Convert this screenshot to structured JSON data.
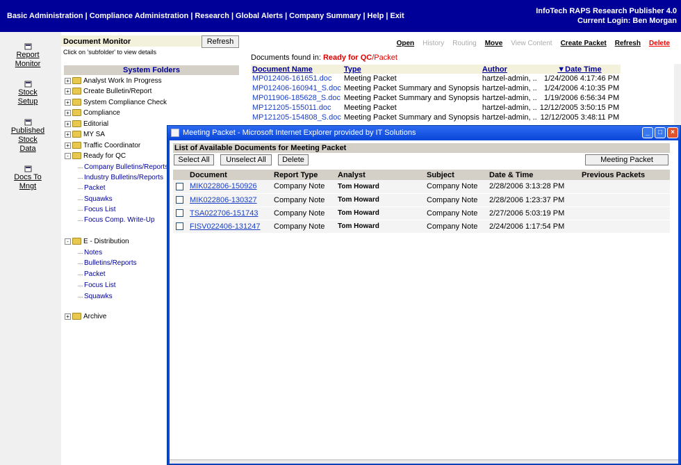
{
  "topnav": {
    "items": [
      "Basic Administration",
      "Compliance Administration",
      "Research",
      "Global Alerts",
      "Company Summary",
      "Help",
      "Exit"
    ],
    "separator": "|"
  },
  "brand": {
    "app_name": "InfoTech RAPS Research Publisher 4.0",
    "login": "Current Login: Ben Morgan"
  },
  "leftnav": {
    "items": [
      {
        "icon": "report-monitor-icon",
        "line1": "Report",
        "line2": "Monitor"
      },
      {
        "icon": "stock-setup-icon",
        "line1": "Stock",
        "line2": "Setup"
      },
      {
        "icon": "published-stock-data-icon",
        "line1": "Published",
        "line2": "Stock",
        "line3": "Data"
      },
      {
        "icon": "docs-to-mngt-icon",
        "line1": "Docs To",
        "line2": "Mngt"
      }
    ]
  },
  "monitor": {
    "title": "Document Monitor",
    "refresh_label": "Refresh",
    "hint": "Click on 'subfolder' to view details",
    "system_folders": "System Folders"
  },
  "tree": {
    "top": [
      {
        "label": "Analyst Work In Progress",
        "expander": "+"
      },
      {
        "label": "Create Bulletin/Report",
        "expander": "+"
      },
      {
        "label": "System Compliance Check",
        "expander": "+"
      },
      {
        "label": "Compliance",
        "expander": "+"
      },
      {
        "label": "Editorial",
        "expander": "+"
      },
      {
        "label": "MY SA",
        "expander": "+"
      },
      {
        "label": "Traffic Coordinator",
        "expander": "+"
      },
      {
        "label": "Ready for QC",
        "expander": "-"
      }
    ],
    "qc_children": [
      "Company Bulletins/Reports",
      "Industry Bulletins/Reports",
      "Packet",
      "Squawks",
      "Focus List",
      "Focus Comp. Write-Up"
    ],
    "edist": {
      "label": "E - Distribution",
      "expander": "-"
    },
    "edist_children": [
      "Notes",
      "Bulletins/Reports",
      "Packet",
      "Focus List",
      "Squawks"
    ],
    "archive": {
      "label": "Archive",
      "expander": "+"
    }
  },
  "actions": {
    "open": "Open",
    "history": "History",
    "routing": "Routing",
    "move": "Move",
    "view_content": "View Content",
    "create_packet": "Create Packet",
    "refresh": "Refresh",
    "delete": "Delete"
  },
  "found": {
    "prefix": "Documents found in: ",
    "folder": "Ready for QC",
    "subfolder": "/Packet"
  },
  "doc_table": {
    "headers": {
      "name": "Document Name",
      "type": "Type",
      "author": "Author",
      "date": "▼Date Time"
    },
    "rows": [
      {
        "name": "MP012406-161651.doc",
        "type": "Meeting Packet",
        "author": "hartzel-admin, ..",
        "date": "1/24/2006 4:17:46 PM"
      },
      {
        "name": "MP012406-160941_S.doc",
        "type": "Meeting Packet Summary and Synopsis",
        "author": "hartzel-admin, ..",
        "date": "1/24/2006 4:10:35 PM"
      },
      {
        "name": "MP011906-185628_S.doc",
        "type": "Meeting Packet Summary and Synopsis",
        "author": "hartzel-admin, ..",
        "date": "1/19/2006 6:56:34 PM"
      },
      {
        "name": "MP121205-155011.doc",
        "type": "Meeting Packet",
        "author": "hartzel-admin, ..",
        "date": "12/12/2005 3:50:15 PM"
      },
      {
        "name": "MP121205-154808_S.doc",
        "type": "Meeting Packet Summary and Synopsis",
        "author": "hartzel-admin, ..",
        "date": "12/12/2005 3:48:11 PM"
      }
    ]
  },
  "popup": {
    "title": "Meeting Packet - Microsoft Internet Explorer provided by IT Solutions",
    "list_header": "List of Available Documents for Meeting Packet",
    "select_all": "Select All",
    "unselect_all": "Unselect All",
    "delete": "Delete",
    "meeting_packet": "Meeting Packet",
    "headers": {
      "document": "Document",
      "report_type": "Report Type",
      "analyst": "Analyst",
      "subject": "Subject",
      "datetime": "Date & Time",
      "previous": "Previous Packets"
    },
    "rows": [
      {
        "document": "MIK022806-150926",
        "report_type": "Company Note",
        "analyst": "Tom Howard",
        "subject": "Company Note",
        "datetime": "2/28/2006 3:13:28 PM",
        "previous": ""
      },
      {
        "document": "MIK022806-130327",
        "report_type": "Company Note",
        "analyst": "Tom Howard",
        "subject": "Company Note",
        "datetime": "2/28/2006 1:23:37 PM",
        "previous": ""
      },
      {
        "document": "TSA022706-151743",
        "report_type": "Company Note",
        "analyst": "Tom Howard",
        "subject": "Company Note",
        "datetime": "2/27/2006 5:03:19 PM",
        "previous": ""
      },
      {
        "document": "FISV022406-131247",
        "report_type": "Company Note",
        "analyst": "Tom Howard",
        "subject": "Company Note",
        "datetime": "2/24/2006 1:17:54 PM",
        "previous": ""
      }
    ]
  },
  "colors": {
    "navy": "#000099",
    "alert_red": "#dd0000",
    "link_blue": "#1a3fc6",
    "xp_blue": "#0a46d8"
  }
}
